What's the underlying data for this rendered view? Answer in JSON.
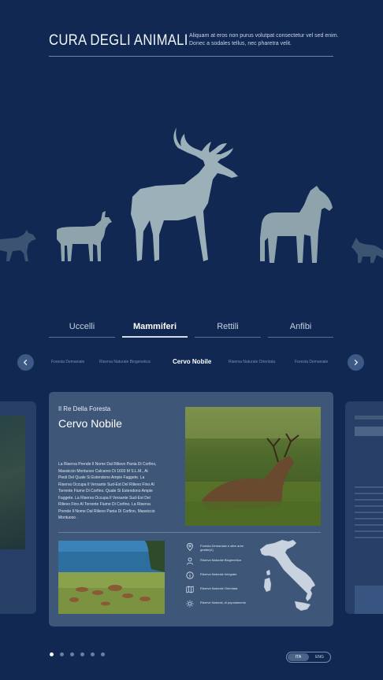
{
  "header": {
    "brand": "CURA DEGLI ANIMALI",
    "tagline": "Aliquam at eros non purus volutpat consectetur vel sed enim. Donec a sodales tellus, nec pharetra velit."
  },
  "tabs": [
    {
      "label": "Uccelli",
      "active": false
    },
    {
      "label": "Mammiferi",
      "active": true
    },
    {
      "label": "Rettili",
      "active": false
    },
    {
      "label": "Anfibi",
      "active": false
    }
  ],
  "sub_nav": {
    "items": [
      {
        "label": "Foresta Demaniale",
        "active": false
      },
      {
        "label": "Riserva Naturale Biogenetica",
        "active": false
      },
      {
        "label": "Cervo Nobile",
        "active": true
      },
      {
        "label": "Riserva Naturale Orientata",
        "active": false
      },
      {
        "label": "Foresta Demaniale",
        "active": false
      }
    ],
    "prev_icon": "chevron-left-icon",
    "next_icon": "chevron-right-icon"
  },
  "card": {
    "kicker": "Il Re Della Foresta",
    "title": "Cervo Nobile",
    "description": "La Riserva Prende Il Nome Dal Rilievo Pania Di Corfino, Massiccio Montuoso Calcareo Di 1603 M S.L.M., Ai Piedi Del Quale Si Estendono Ampie Faggete. La Riserva Occupa Il Versante Sud-Est Del Rilievo Fino Al Torrente Fiume Di Corfino. Quale Si Estendono Ampie Faggete. La Riserva Occupa Il Versante Sud-Est Del Rilievo Fino Al Torrente Fiume Di Corfino. La Riserva Prende Il Nome Dal Rilievo Pania Di Corfino, Massiccio Montuoso .",
    "features": [
      {
        "icon": "location-pin-icon",
        "label": "Foresta Demaniale e altre aree gestite(4)"
      },
      {
        "icon": "person-icon",
        "label": "Riserva Naturale Biogenetica"
      },
      {
        "icon": "info-icon",
        "label": "Riserva Naturale Integrale"
      },
      {
        "icon": "map-icon",
        "label": "Riserva Naturale Orientata"
      },
      {
        "icon": "sun-icon",
        "label": "Riserve Naturali, di popolamento"
      }
    ]
  },
  "pagination": {
    "count": 6,
    "active_index": 0
  },
  "language": {
    "options": [
      "ITA",
      "ENG"
    ],
    "active": "ITA"
  },
  "colors": {
    "background": "#102852",
    "card": "#3e5678",
    "silhouette": "#8fa3ad"
  }
}
